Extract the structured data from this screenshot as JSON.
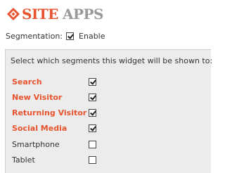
{
  "logo": {
    "word1": "SITE",
    "word2": "APPS",
    "mark_icon": "diamond-logo-icon"
  },
  "colors": {
    "accent": "#e8542f",
    "logo_gray": "#9a9a9a",
    "panel_bg": "#ececec"
  },
  "segmentation": {
    "label": "Segmentation:",
    "enable_label": "Enable",
    "enabled": true
  },
  "panel": {
    "heading": "Select which segments this widget will be shown to:",
    "segments": [
      {
        "name": "Search",
        "checked": true
      },
      {
        "name": "New Visitor",
        "checked": true
      },
      {
        "name": "Returning Visitor",
        "checked": true
      },
      {
        "name": "Social Media",
        "checked": true
      },
      {
        "name": "Smartphone",
        "checked": false
      },
      {
        "name": "Tablet",
        "checked": false
      }
    ]
  }
}
